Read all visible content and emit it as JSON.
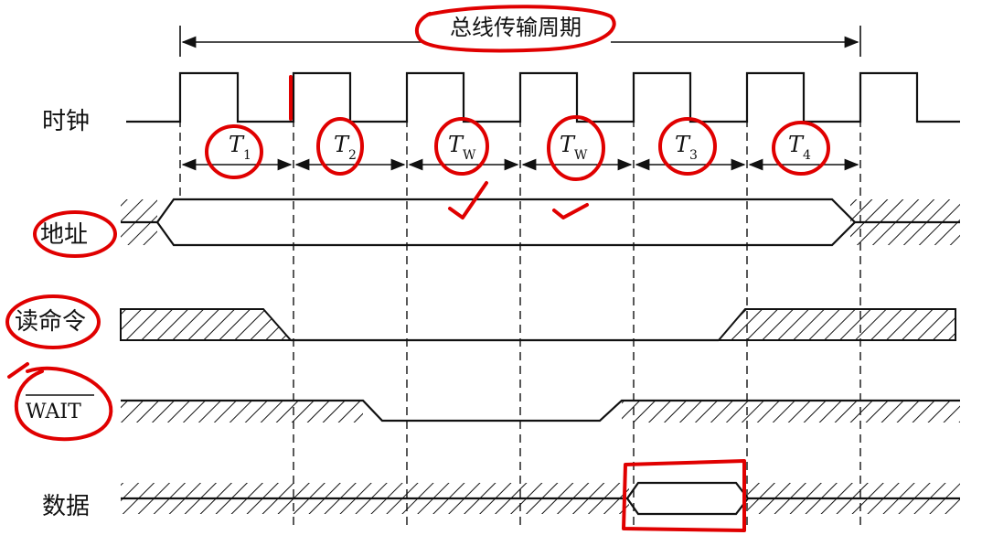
{
  "title": "总线传输周期",
  "signals": {
    "clock": "时钟",
    "address": "地址",
    "read_cmd": "读命令",
    "wait": "WAIT",
    "data": "数据"
  },
  "periods": [
    {
      "main": "T",
      "sub": "1"
    },
    {
      "main": "T",
      "sub": "2"
    },
    {
      "main": "T",
      "sub": "W"
    },
    {
      "main": "T",
      "sub": "W"
    },
    {
      "main": "T",
      "sub": "3"
    },
    {
      "main": "T",
      "sub": "4"
    }
  ],
  "colors": {
    "ink": "#111111",
    "annotation": "#e00000"
  },
  "annotations": {
    "type": "red hand-drawn circles and check marks"
  }
}
